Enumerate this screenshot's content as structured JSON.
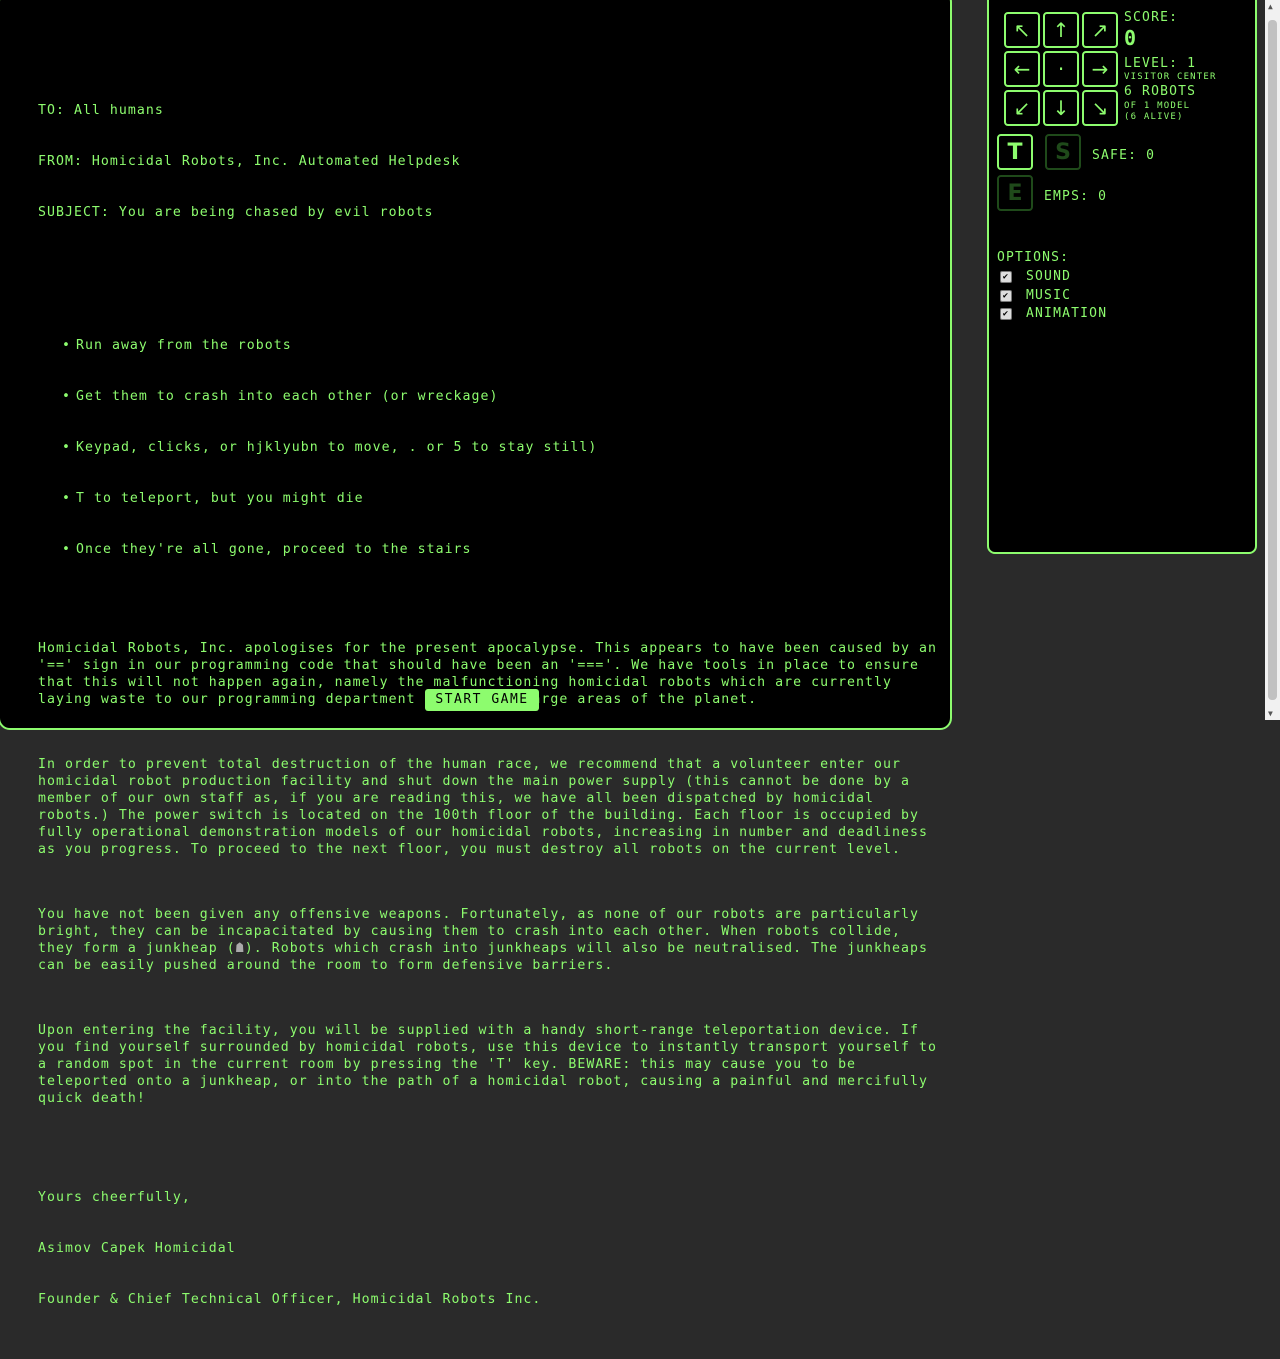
{
  "letter": {
    "to": "TO: All humans",
    "from": "FROM: Homicidal Robots, Inc. Automated Helpdesk",
    "subject": "SUBJECT: You are being chased by evil robots",
    "bullets": [
      "Run away from the robots",
      "Get them to crash into each other (or wreckage)",
      "Keypad, clicks, or hjklyubn to move, . or 5 to stay still)",
      "T to teleport, but you might die",
      "Once they're all gone, proceed to the stairs"
    ],
    "para1": "Homicidal Robots, Inc. apologises for the present apocalypse. This appears to have been caused by an '==' sign in our programming code that should have been an '==='. We have tools in place to ensure that this will not happen again, namely the malfunctioning homicidal robots which are currently laying waste to our programming department as well as large areas of the planet.",
    "para2": "In order to prevent total destruction of the human race, we recommend that a volunteer enter our homicidal robot production facility and shut down the main power supply (this cannot be done by a member of our own staff as, if you are reading this, we have all been dispatched by homicidal robots.) The power switch is located on the 100th floor of the building. Each floor is occupied by fully operational demonstration models of our homicidal robots, increasing in number and deadliness as you progress. To proceed to the next floor, you must destroy all robots on the current level.",
    "para3_a": "You have not been given any offensive weapons. Fortunately, as none of our robots are particularly bright, they can be incapacitated by causing them to crash into each other. When robots collide, they form a junkheap (",
    "para3_glyph": "☗",
    "para3_b": "). Robots which crash into junkheaps will also be neutralised. The junkheaps can be easily pushed around the room to form defensive barriers.",
    "para4": "Upon entering the facility, you will be supplied with a handy short-range teleportation device. If you find yourself surrounded by homicidal robots, use this device to instantly transport yourself to a random spot in the current room by pressing the 'T' key. BEWARE: this may cause you to be teleported onto a junkheap, or into the path of a homicidal robot, causing a painful and mercifully quick death!",
    "signoff": "Yours cheerfully,",
    "signer": "Asimov Capek Homicidal",
    "signer_title": "Founder & Chief Technical Officer, Homicidal Robots Inc."
  },
  "start_button": "START GAME",
  "keypad": [
    {
      "glyph": "↖",
      "icon": "arrow-up-left-icon"
    },
    {
      "glyph": "↑",
      "icon": "arrow-up-icon"
    },
    {
      "glyph": "↗",
      "icon": "arrow-up-right-icon"
    },
    {
      "glyph": "←",
      "icon": "arrow-left-icon"
    },
    {
      "glyph": "·",
      "icon": "stay-dot-icon"
    },
    {
      "glyph": "→",
      "icon": "arrow-right-icon"
    },
    {
      "glyph": "↙",
      "icon": "arrow-down-left-icon"
    },
    {
      "glyph": "↓",
      "icon": "arrow-down-icon"
    },
    {
      "glyph": "↘",
      "icon": "arrow-down-right-icon"
    }
  ],
  "stats": {
    "score_label": "SCORE:",
    "score_value": "0",
    "level_label": "LEVEL: 1",
    "level_name": "VISITOR CENTER",
    "robots_label": "6 ROBOTS",
    "robots_model": "OF 1 MODEL",
    "robots_alive": "(6 ALIVE)"
  },
  "powers": {
    "teleport_key": "T",
    "safe_key": "S",
    "emp_key": "E",
    "safe_text": "SAFE: 0",
    "emps_text": "EMPS: 0"
  },
  "options": {
    "label": "OPTIONS:",
    "sound": "SOUND",
    "music": "MUSIC",
    "animation": "ANIMATION",
    "sound_checked": true,
    "music_checked": true,
    "animation_checked": true
  },
  "colors": {
    "accent": "#8dfc6e",
    "background": "#000000",
    "dim": "#1f4a1a"
  }
}
